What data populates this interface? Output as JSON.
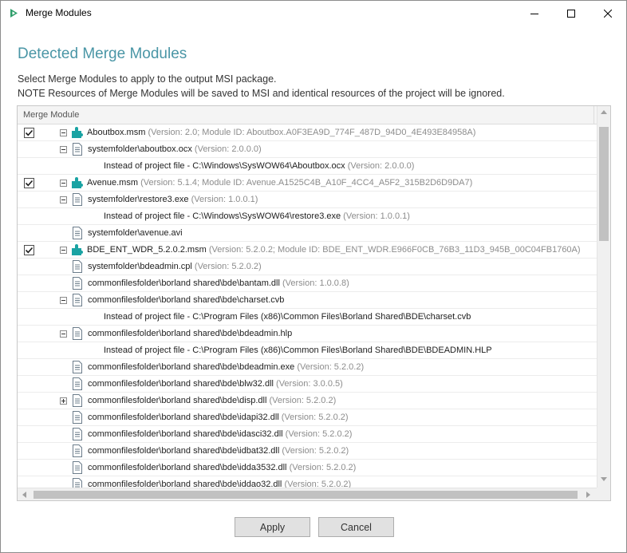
{
  "window": {
    "title": "Merge Modules"
  },
  "heading": "Detected Merge Modules",
  "description": {
    "line1": "Select Merge Modules to apply to the output MSI package.",
    "line2": "NOTE Resources of Merge Modules will be saved to MSI and identical resources of the project will be ignored."
  },
  "grid": {
    "column_header": "Merge Module",
    "rows": [
      {
        "kind": "module",
        "checked": true,
        "expander": "minus",
        "level": 0,
        "text": "Aboutbox.msm",
        "version": "(Version: 2.0; Module ID: Aboutbox.A0F3EA9D_774F_487D_94D0_4E493E84958A)"
      },
      {
        "kind": "file",
        "expander": "minus",
        "level": 1,
        "text": "systemfolder\\aboutbox.ocx",
        "version": "(Version: 2.0.0.0)"
      },
      {
        "kind": "note",
        "level": 2,
        "text": "Instead of project file - C:\\Windows\\SysWOW64\\Aboutbox.ocx",
        "version": "(Version: 2.0.0.0)"
      },
      {
        "kind": "module",
        "checked": true,
        "expander": "minus",
        "level": 0,
        "text": "Avenue.msm",
        "version": "(Version: 5.1.4; Module ID: Avenue.A1525C4B_A10F_4CC4_A5F2_315B2D6D9DA7)"
      },
      {
        "kind": "file",
        "expander": "minus",
        "level": 1,
        "text": "systemfolder\\restore3.exe",
        "version": "(Version: 1.0.0.1)"
      },
      {
        "kind": "note",
        "level": 2,
        "text": "Instead of project file - C:\\Windows\\SysWOW64\\restore3.exe",
        "version": "(Version: 1.0.0.1)"
      },
      {
        "kind": "file",
        "expander": "none",
        "level": 1,
        "text": "systemfolder\\avenue.avi",
        "version": ""
      },
      {
        "kind": "module",
        "checked": true,
        "expander": "minus",
        "level": 0,
        "text": "BDE_ENT_WDR_5.2.0.2.msm",
        "version": "(Version: 5.2.0.2; Module ID: BDE_ENT_WDR.E966F0CB_76B3_11D3_945B_00C04FB1760A)"
      },
      {
        "kind": "file",
        "expander": "none",
        "level": 1,
        "text": "systemfolder\\bdeadmin.cpl",
        "version": "(Version: 5.2.0.2)"
      },
      {
        "kind": "file",
        "expander": "none",
        "level": 1,
        "text": "commonfilesfolder\\borland shared\\bde\\bantam.dll",
        "version": "(Version: 1.0.0.8)"
      },
      {
        "kind": "file",
        "expander": "minus",
        "level": 1,
        "text": "commonfilesfolder\\borland shared\\bde\\charset.cvb",
        "version": ""
      },
      {
        "kind": "note",
        "level": 2,
        "text": "Instead of project file - C:\\Program Files (x86)\\Common Files\\Borland Shared\\BDE\\charset.cvb",
        "version": ""
      },
      {
        "kind": "file",
        "expander": "minus",
        "level": 1,
        "text": "commonfilesfolder\\borland shared\\bde\\bdeadmin.hlp",
        "version": ""
      },
      {
        "kind": "note",
        "level": 2,
        "text": "Instead of project file - C:\\Program Files (x86)\\Common Files\\Borland Shared\\BDE\\BDEADMIN.HLP",
        "version": ""
      },
      {
        "kind": "file",
        "expander": "none",
        "level": 1,
        "text": "commonfilesfolder\\borland shared\\bde\\bdeadmin.exe",
        "version": "(Version: 5.2.0.2)"
      },
      {
        "kind": "file",
        "expander": "none",
        "level": 1,
        "text": "commonfilesfolder\\borland shared\\bde\\blw32.dll",
        "version": "(Version: 3.0.0.5)"
      },
      {
        "kind": "file",
        "expander": "plus",
        "level": 1,
        "text": "commonfilesfolder\\borland shared\\bde\\disp.dll",
        "version": "(Version: 5.2.0.2)"
      },
      {
        "kind": "file",
        "expander": "none",
        "level": 1,
        "text": "commonfilesfolder\\borland shared\\bde\\idapi32.dll",
        "version": "(Version: 5.2.0.2)"
      },
      {
        "kind": "file",
        "expander": "none",
        "level": 1,
        "text": "commonfilesfolder\\borland shared\\bde\\idasci32.dll",
        "version": "(Version: 5.2.0.2)"
      },
      {
        "kind": "file",
        "expander": "none",
        "level": 1,
        "text": "commonfilesfolder\\borland shared\\bde\\idbat32.dll",
        "version": "(Version: 5.2.0.2)"
      },
      {
        "kind": "file",
        "expander": "none",
        "level": 1,
        "text": "commonfilesfolder\\borland shared\\bde\\idda3532.dll",
        "version": "(Version: 5.2.0.2)"
      },
      {
        "kind": "file",
        "expander": "none",
        "level": 1,
        "text": "commonfilesfolder\\borland shared\\bde\\iddao32.dll",
        "version": "(Version: 5.2.0.2)"
      }
    ]
  },
  "buttons": {
    "apply": "Apply",
    "cancel": "Cancel"
  },
  "colors": {
    "heading": "#4a96a6",
    "module_icon": "#1aa3a3",
    "app_icon": "#2e9e6a"
  }
}
